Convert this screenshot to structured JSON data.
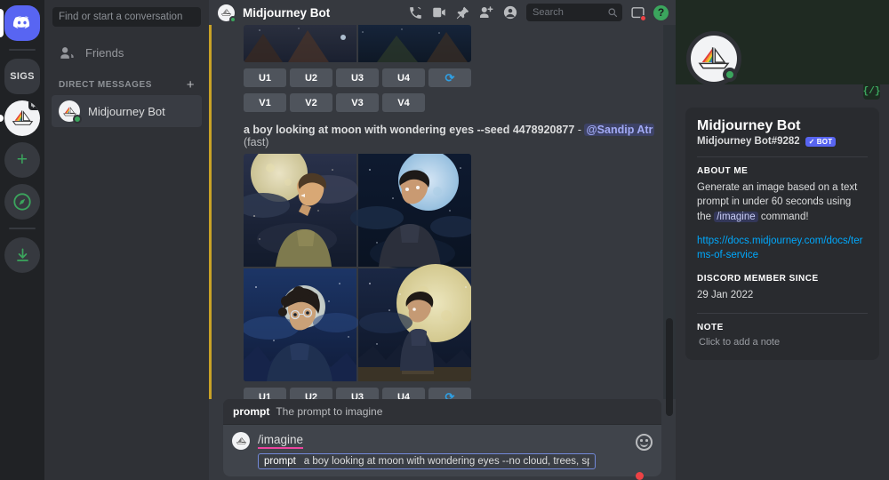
{
  "rail": {
    "items": [
      {
        "name": "discord-home",
        "label": "",
        "icon": "discord-logo"
      },
      {
        "name": "server-sigs",
        "label": "SIGS",
        "icon": "text"
      },
      {
        "name": "server-midjourney",
        "label": "",
        "icon": "sailboat"
      },
      {
        "name": "add-server",
        "label": "+",
        "icon": "plus"
      },
      {
        "name": "explore-servers",
        "label": "",
        "icon": "compass"
      },
      {
        "name": "download-apps",
        "label": "",
        "icon": "download"
      }
    ]
  },
  "sidebar": {
    "search_placeholder": "Find or start a conversation",
    "friends_label": "Friends",
    "dm_header": "DIRECT MESSAGES",
    "dm_add": "+",
    "dms": [
      {
        "name": "Midjourney Bot",
        "status": "online"
      }
    ]
  },
  "topbar": {
    "title": "Midjourney Bot",
    "search_placeholder": "Search",
    "icons": [
      "call-icon",
      "video-icon",
      "pin-icon",
      "add-friend-icon",
      "profile-icon",
      "search-icon",
      "inbox-icon",
      "help-icon"
    ],
    "help_glyph": "?"
  },
  "messages": {
    "prompt_text": "a boy looking at moon with wondering eyes --seed 4478920877",
    "separator": "-",
    "mention": "@Sandip Atr",
    "speed": "(fast)",
    "upscale_buttons": [
      "U1",
      "U2",
      "U3",
      "U4"
    ],
    "variation_buttons": [
      "V1",
      "V2",
      "V3",
      "V4"
    ],
    "reroll_label": "⟳"
  },
  "composer": {
    "hint_key": "prompt",
    "hint_desc": "The prompt to imagine",
    "command": "/imagine",
    "arg_key": "prompt",
    "arg_value": "a boy looking at moon with wondering eyes --no cloud, trees, specs",
    "emoji_icon": "emoji-icon"
  },
  "profile": {
    "name": "Midjourney Bot",
    "tag": "Midjourney Bot#9282",
    "bot_badge": "BOT",
    "bot_check": "✓",
    "about_header": "ABOUT ME",
    "about_pre": "Generate an image based on a text prompt in under 60 seconds using the ",
    "about_code": "/imagine",
    "about_post": " command!",
    "link": "https://docs.midjourney.com/docs/terms-of-service",
    "member_header": "DISCORD MEMBER SINCE",
    "member_since": "29 Jan 2022",
    "note_header": "NOTE",
    "note_placeholder": "Click to add a note",
    "slash_badge": "{/}"
  },
  "colors": {
    "blurple": "#5865f2",
    "green": "#3ba55d",
    "red": "#ed4245",
    "link": "#00a8fc",
    "gold_edge": "#c9a227",
    "pink_underline": "#eb459e"
  }
}
